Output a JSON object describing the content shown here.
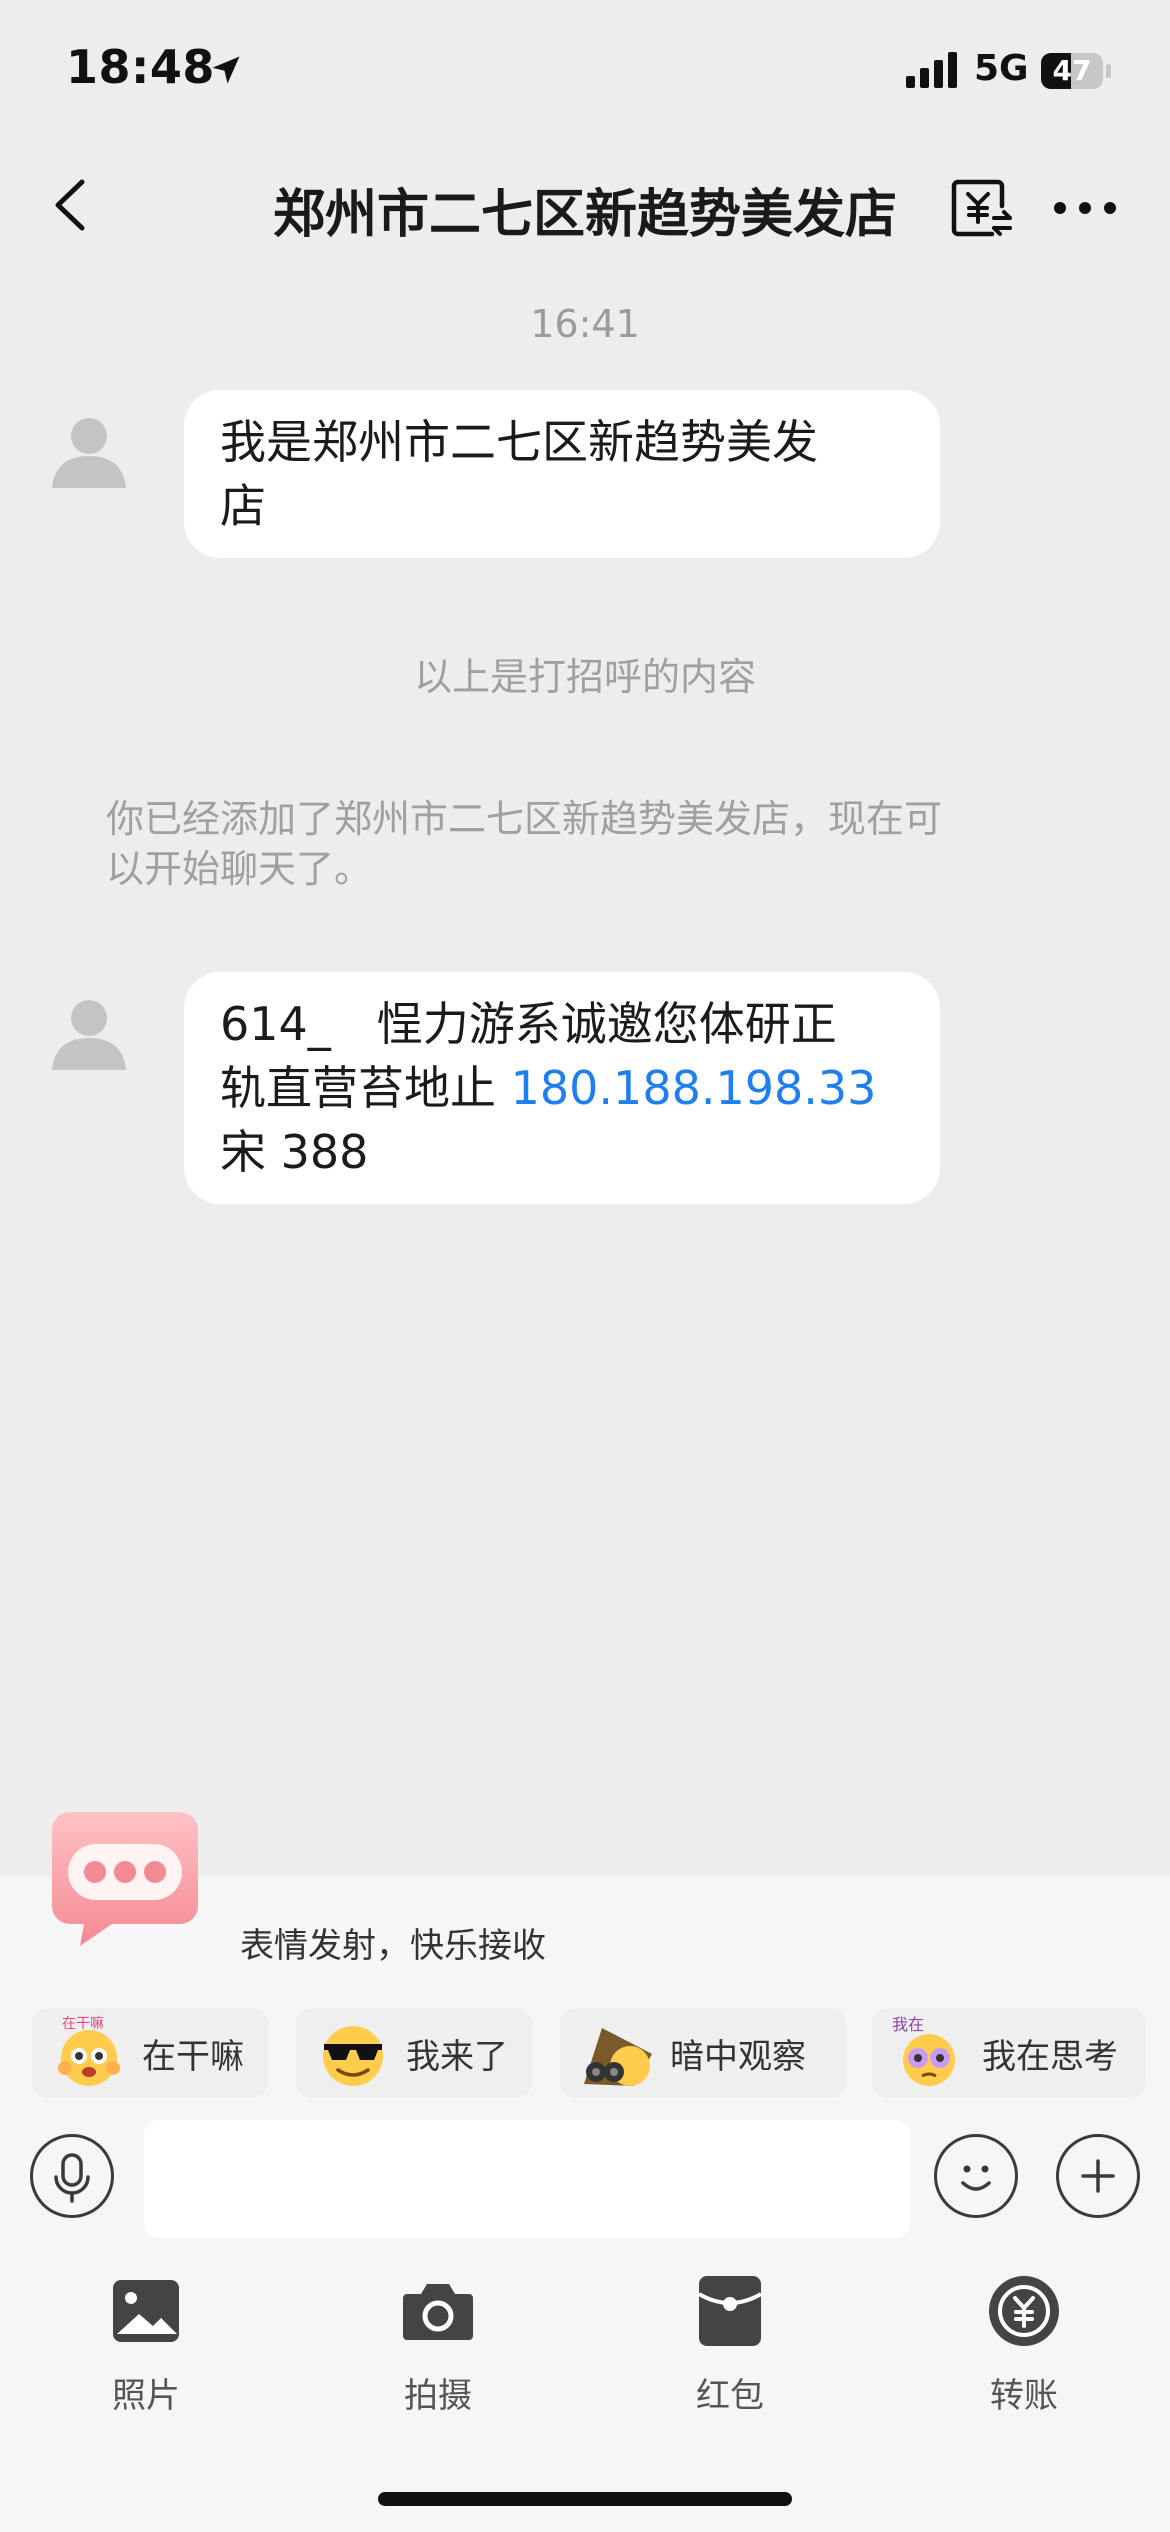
{
  "status": {
    "time": "18:48",
    "network": "5G",
    "battery": "47"
  },
  "nav": {
    "title": "郑州市二七区新趋势美发店"
  },
  "chat": {
    "timestamp": "16:41",
    "greeting_message": [
      "我是郑州市二七区新趋势美发",
      "店"
    ],
    "greeting_note": "以上是打招呼的内容",
    "added_notice": [
      "你已经添加了郑州市二七区新趋势美发店，现在可",
      "以开始聊天了。"
    ],
    "message2": {
      "line1": "614_　悜力游系诚邀您体研正",
      "line2_prefix": "轨直营苔地止 ",
      "line2_link": "180.188.198.33",
      "line3": "宋 388"
    }
  },
  "emoji_promo": {
    "text": "表情发射，快乐接收"
  },
  "emoji_chips": [
    {
      "label": "在干嘛",
      "icon": "peeking-face-icon"
    },
    {
      "label": "我来了",
      "icon": "sunglasses-face-icon"
    },
    {
      "label": "暗中观察",
      "icon": "binoculars-face-icon"
    },
    {
      "label": "我在思考",
      "icon": "thinking-face-icon"
    }
  ],
  "tools": [
    {
      "label": "照片",
      "icon": "photo-icon"
    },
    {
      "label": "拍摄",
      "icon": "camera-icon"
    },
    {
      "label": "红包",
      "icon": "red-packet-icon"
    },
    {
      "label": "转账",
      "icon": "transfer-icon"
    }
  ],
  "colors": {
    "background": "#ededed",
    "bubble": "#ffffff",
    "link": "#1f7ff0"
  }
}
